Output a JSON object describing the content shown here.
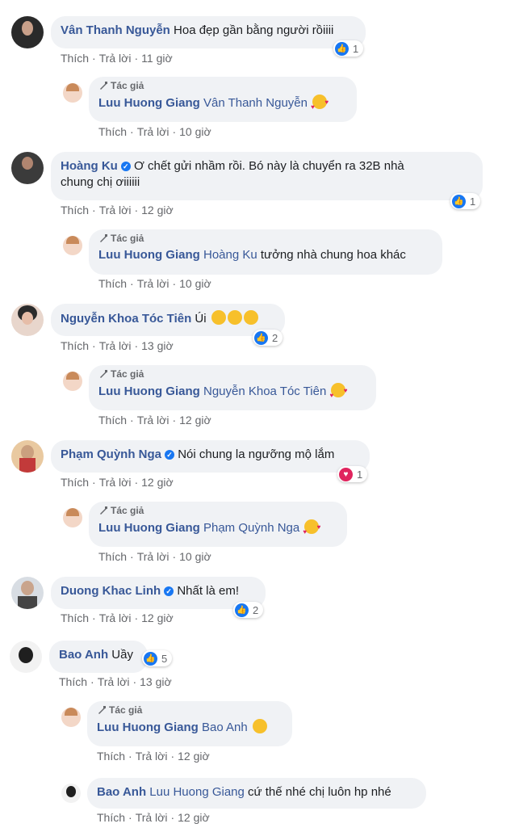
{
  "comments": [
    {
      "author": "Vân Thanh Nguyễn",
      "text": "Hoa đẹp gần bằng người rồiiii",
      "actions": [
        "Thích",
        "Trả lời"
      ],
      "time": "11 giờ",
      "reaction": {
        "type": "like",
        "count": "1"
      }
    },
    {
      "author_tag": "Tác giả",
      "author": "Luu Huong Giang",
      "mention": "Vân Thanh Nguyễn",
      "text": "",
      "emoji": "smiling-hearts",
      "actions": [
        "Thích",
        "Trả lời"
      ],
      "time": "10 giờ"
    },
    {
      "author": "Hoàng Ku",
      "verified": true,
      "text_line1": "Ơ chết gửi nhầm rồi. Bó này là chuyển ra 32B nhà",
      "text_line2": "chung chị ơiiiiii",
      "actions": [
        "Thích",
        "Trả lời"
      ],
      "time": "12 giờ",
      "reaction": {
        "type": "like",
        "count": "1"
      }
    },
    {
      "author_tag": "Tác giả",
      "author": "Luu Huong Giang",
      "mention": "Hoàng Ku",
      "text": "tưởng nhà chung hoa khác",
      "actions": [
        "Thích",
        "Trả lời"
      ],
      "time": "10 giờ"
    },
    {
      "author": "Nguyễn Khoa Tóc Tiên",
      "text": "Úi",
      "emoji": "laughing-tears x3",
      "actions": [
        "Thích",
        "Trả lời"
      ],
      "time": "13 giờ",
      "reaction": {
        "type": "like",
        "count": "2"
      }
    },
    {
      "author_tag": "Tác giả",
      "author": "Luu Huong Giang",
      "mention": "Nguyễn Khoa Tóc Tiên",
      "emoji": "smiling-hearts",
      "actions": [
        "Thích",
        "Trả lời"
      ],
      "time": "12 giờ"
    },
    {
      "author": "Phạm Quỳnh Nga",
      "verified": true,
      "text": "Nói chung la ngưỡng mộ lắm",
      "actions": [
        "Thích",
        "Trả lời"
      ],
      "time": "12 giờ",
      "reaction": {
        "type": "love",
        "count": "1"
      }
    },
    {
      "author_tag": "Tác giả",
      "author": "Luu Huong Giang",
      "mention": "Phạm Quỳnh Nga",
      "emoji": "smiling-hearts",
      "actions": [
        "Thích",
        "Trả lời"
      ],
      "time": "10 giờ"
    },
    {
      "author": "Duong Khac Linh",
      "verified": true,
      "text": "Nhất là em!",
      "actions": [
        "Thích",
        "Trả lời"
      ],
      "time": "12 giờ",
      "reaction": {
        "type": "like",
        "count": "2"
      }
    },
    {
      "author": "Bao Anh",
      "text": "Uầy",
      "actions": [
        "Thích",
        "Trả lời"
      ],
      "time": "13 giờ",
      "reaction": {
        "type": "like",
        "count": "5"
      }
    },
    {
      "author_tag": "Tác giả",
      "author": "Luu Huong Giang",
      "mention": "Bao Anh",
      "emoji": "smiling-face",
      "actions": [
        "Thích",
        "Trả lời"
      ],
      "time": "12 giờ"
    },
    {
      "author": "Bao Anh",
      "mention": "Luu Huong Giang",
      "text": "cứ thế nhé chị luôn hp nhé",
      "actions": [
        "Thích",
        "Trả lời"
      ],
      "time": "12 giờ"
    }
  ],
  "colors": {
    "name": "#385898",
    "bubble": "#f0f2f5",
    "like": "#1877f2",
    "love": "#e0245e"
  }
}
